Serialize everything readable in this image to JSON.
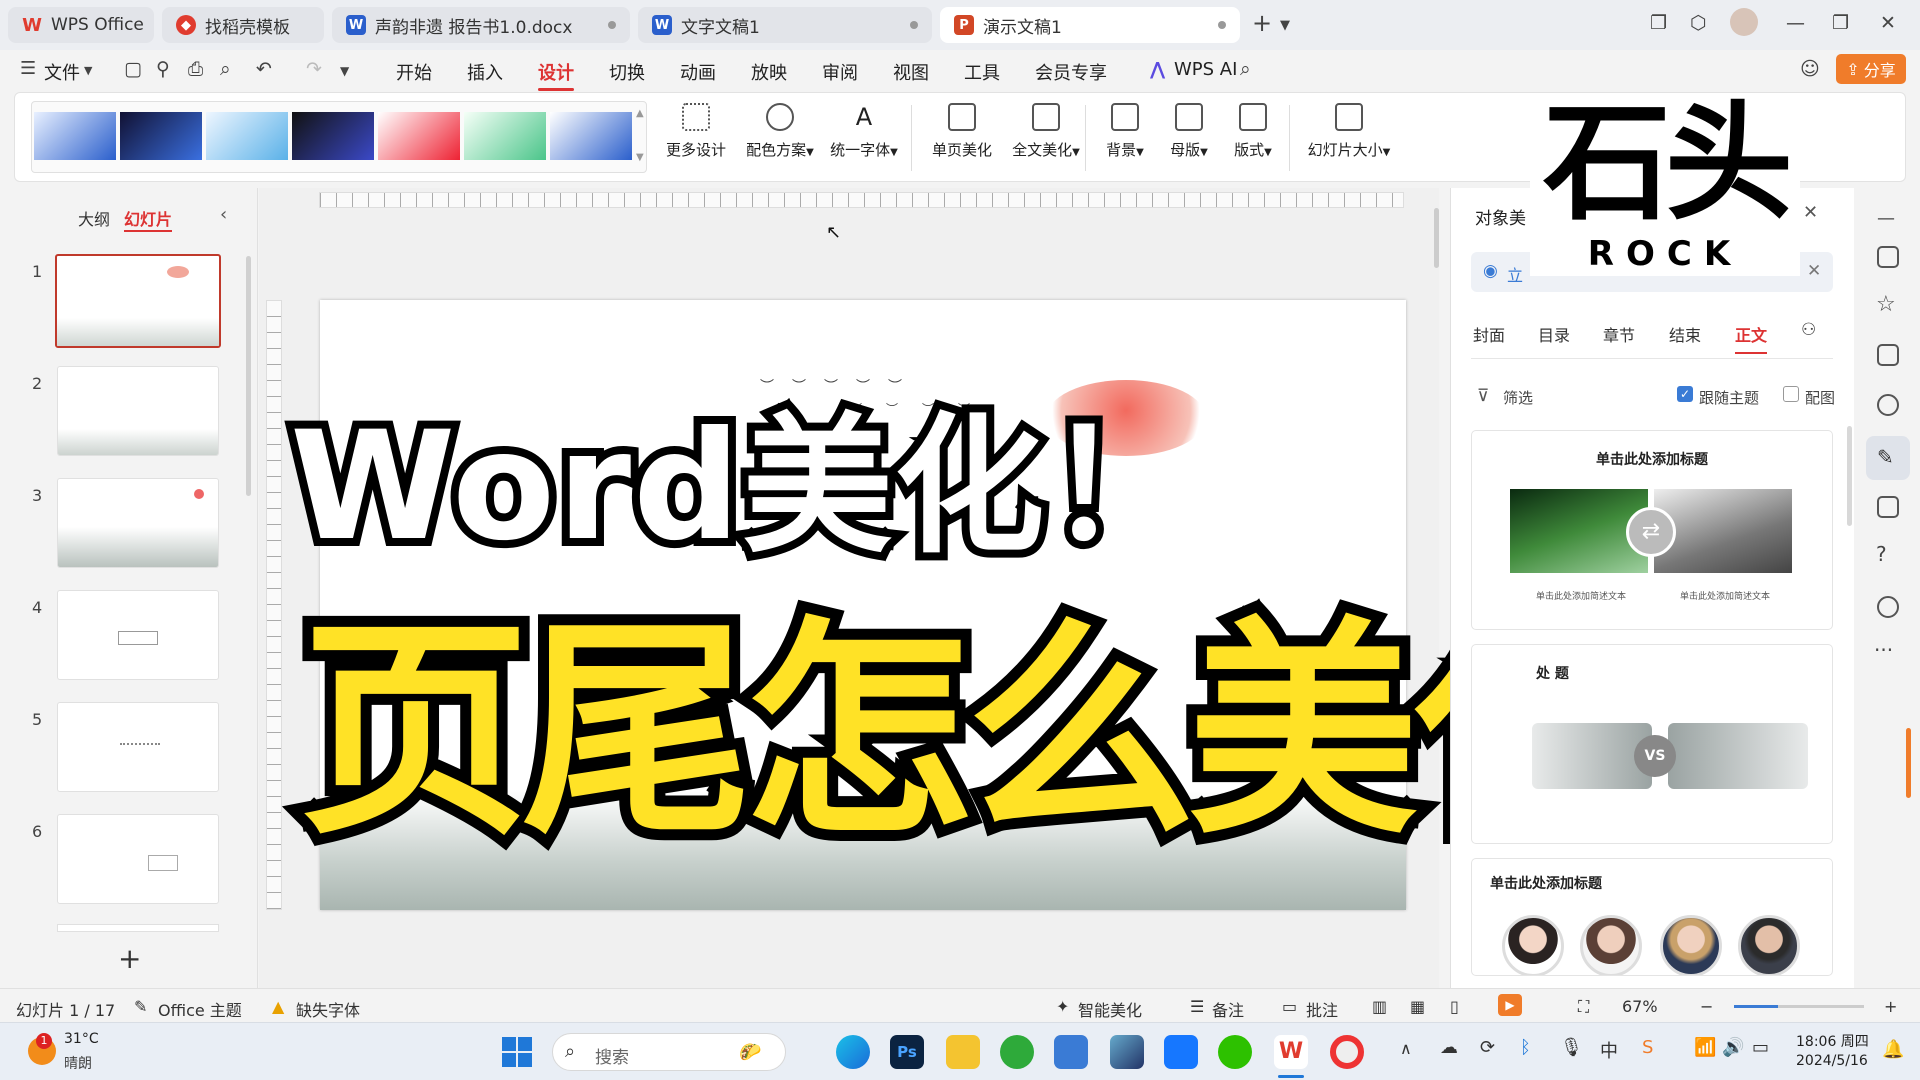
{
  "tabs": [
    {
      "label": "WPS Office",
      "icon": "wps-logo-icon",
      "color": "#e03c2f"
    },
    {
      "label": "找稻壳模板",
      "icon": "docer-icon",
      "color": "#e03c2f"
    },
    {
      "label": "声韵非遗 报告书1.0.docx",
      "icon": "word-doc-icon",
      "color": "#2b5fcc"
    },
    {
      "label": "文字文稿1",
      "icon": "word-doc-icon",
      "color": "#2b5fcc"
    },
    {
      "label": "演示文稿1",
      "icon": "ppt-doc-icon",
      "color": "#d24726"
    }
  ],
  "tab_icon_letters": {
    "word": "W",
    "ppt": "P"
  },
  "menu": {
    "file": "文件",
    "items": [
      "开始",
      "插入",
      "设计",
      "切换",
      "动画",
      "放映",
      "审阅",
      "视图",
      "工具",
      "会员专享"
    ],
    "active": "设计",
    "wps_ai": "WPS AI",
    "share": "分享"
  },
  "ribbon": {
    "more_design": "更多设计",
    "color_scheme": "配色方案",
    "unify_font": "统一字体",
    "single_page": "单页美化",
    "full_text": "全文美化",
    "background": "背景",
    "master": "母版",
    "layout": "版式",
    "slide_size": "幻灯片大小"
  },
  "left_panel": {
    "tab_outline": "大纲",
    "tab_slides": "幻灯片",
    "slide_numbers": [
      "1",
      "2",
      "3",
      "4",
      "5",
      "6"
    ],
    "add_symbol": "+"
  },
  "slide": {
    "line1": "Word美化！",
    "line2": "页尾怎么美化"
  },
  "watermark": {
    "chars": "石头",
    "latin": "ROCK"
  },
  "right_panel": {
    "title": "对象美",
    "search_prefix": "立",
    "tabs": [
      "封面",
      "目录",
      "章节",
      "结束",
      "正文"
    ],
    "active_tab": "正文",
    "filter": "筛选",
    "follow_theme": "跟随主题",
    "match_image": "配图",
    "follow_theme_checked": true,
    "match_image_checked": false,
    "card1_title": "单击此处添加标题",
    "card1_caption_left": "单击此处添加简述文本",
    "card1_caption_right": "单击此处添加简述文本",
    "card2_title": "处 题",
    "card2_vs": "VS",
    "card3_title": "单击此处添加标题"
  },
  "status": {
    "slide_info": "幻灯片 1 / 17",
    "theme": "Office 主题",
    "missing_font": "缺失字体",
    "smart": "智能美化",
    "notes": "备注",
    "comments": "批注",
    "zoom": "67%",
    "minus": "−",
    "plus": "+"
  },
  "taskbar": {
    "temp": "31°C",
    "weather": "晴朗",
    "weather_badge": "1",
    "search": "搜索",
    "time": "18:06 周四",
    "date": "2024/5/16"
  },
  "colors": {
    "accent": "#d33",
    "share_button": "#f07c2a",
    "title_yellow": "#ffe226"
  }
}
